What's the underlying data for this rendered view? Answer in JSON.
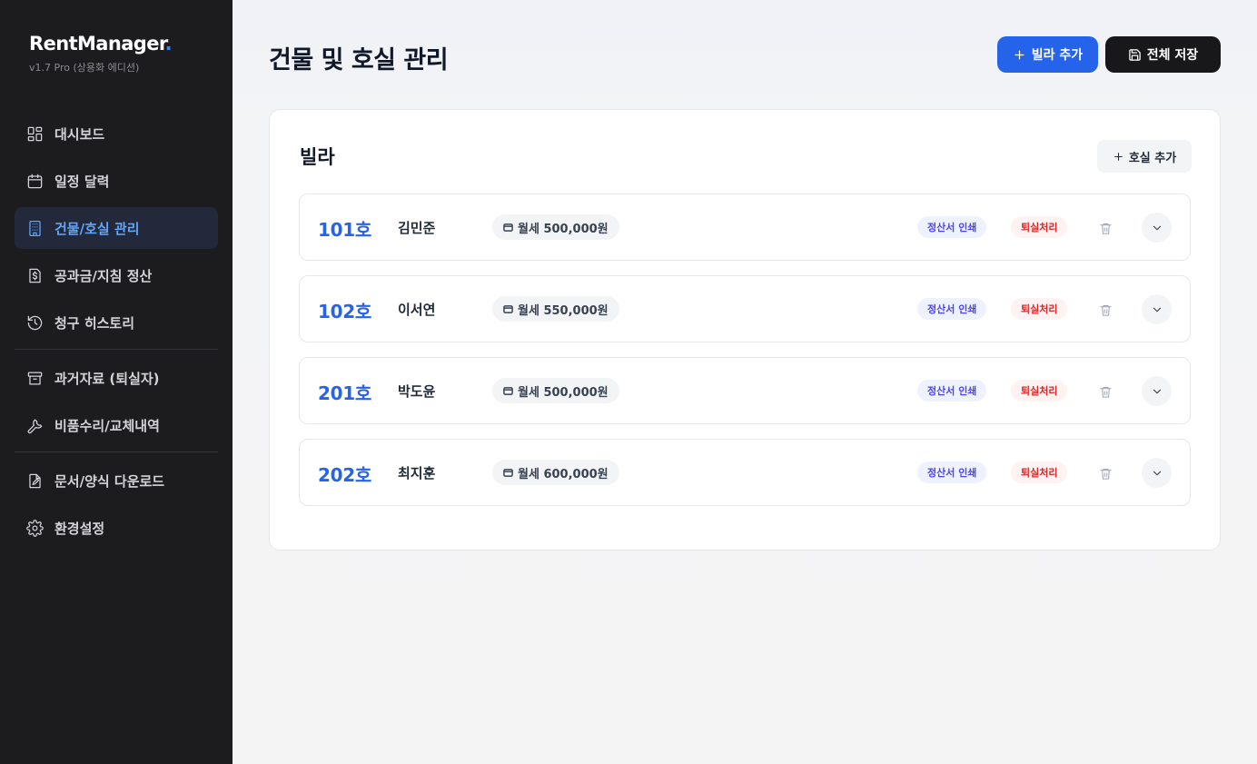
{
  "brand": {
    "name": "RentManager",
    "dot": ".",
    "version": "v1.7 Pro (상용화 에디션)"
  },
  "sidebar": {
    "items": [
      {
        "label": "대시보드",
        "icon": "dashboard-grid-icon"
      },
      {
        "label": "일정 달력",
        "icon": "calendar-icon"
      },
      {
        "label": "건물/호실 관리",
        "icon": "building-icon",
        "active": true
      },
      {
        "label": "공과금/지침 정산",
        "icon": "receipt-dollar-icon"
      },
      {
        "label": "청구 히스토리",
        "icon": "history-icon"
      },
      {
        "label": "과거자료 (퇴실자)",
        "icon": "archive-icon"
      },
      {
        "label": "비품수리/교체내역",
        "icon": "wrench-icon"
      },
      {
        "label": "문서/양식 다운로드",
        "icon": "document-edit-icon"
      },
      {
        "label": "환경설정",
        "icon": "gear-icon"
      }
    ]
  },
  "header": {
    "title": "건물 및 호실 관리",
    "add_villa_label": "빌라 추가",
    "save_all_label": "전체 저장"
  },
  "building": {
    "name": "빌라",
    "add_room_label": "호실 추가",
    "rooms": [
      {
        "room": "101호",
        "tenant": "김민준",
        "rent": "월세 500,000원",
        "print_label": "정산서 인쇄",
        "moveout_label": "퇴실처리"
      },
      {
        "room": "102호",
        "tenant": "이서연",
        "rent": "월세 550,000원",
        "print_label": "정산서 인쇄",
        "moveout_label": "퇴실처리"
      },
      {
        "room": "201호",
        "tenant": "박도윤",
        "rent": "월세 500,000원",
        "print_label": "정산서 인쇄",
        "moveout_label": "퇴실처리"
      },
      {
        "room": "202호",
        "tenant": "최지훈",
        "rent": "월세 600,000원",
        "print_label": "정산서 인쇄",
        "moveout_label": "퇴실처리"
      }
    ]
  },
  "colors": {
    "accent": "#2563eb",
    "sidebar_bg": "#1c1c1f",
    "active_text": "#60a5fa",
    "danger": "#dc2626"
  }
}
